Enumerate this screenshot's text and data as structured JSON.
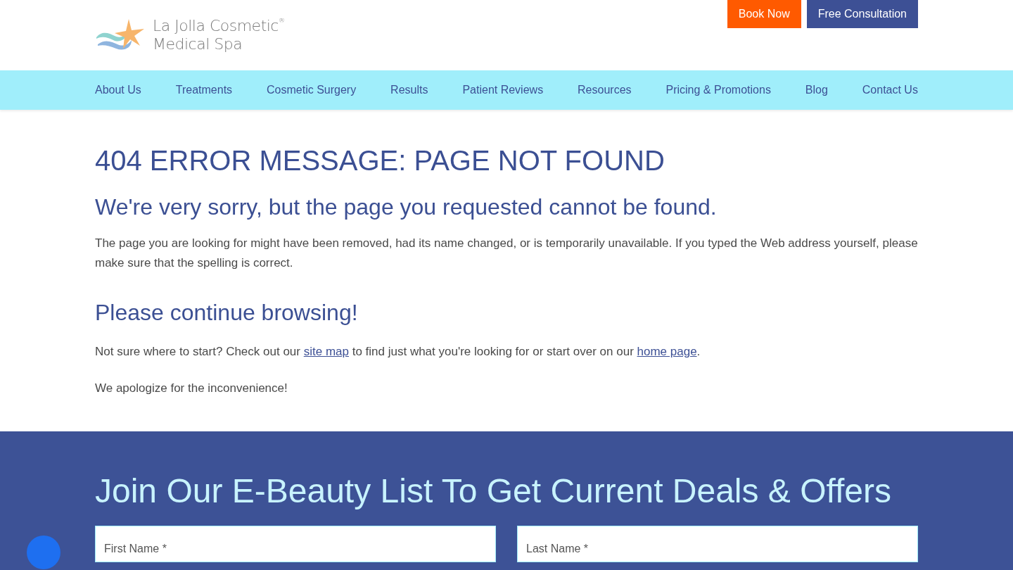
{
  "header": {
    "logo": {
      "line1": "La Jolla Cosmetic",
      "mark": "®",
      "line2": "Medical Spa"
    },
    "buttons": [
      {
        "label": "Book Now",
        "kind": "accent"
      },
      {
        "label": "Free Consultation",
        "kind": "primary"
      }
    ]
  },
  "nav": {
    "items": [
      "About Us",
      "Treatments",
      "Cosmetic Surgery",
      "Results",
      "Patient Reviews",
      "Resources",
      "Pricing & Promotions",
      "Blog",
      "Contact Us"
    ]
  },
  "main": {
    "title": "404 ERROR MESSAGE: PAGE NOT FOUND",
    "subtitle": "We're very sorry, but the page you requested cannot be found.",
    "paragraph": "The page you are looking for might have been removed, had its name changed, or is temporarily unavailable. If you typed the Web address yourself, please make sure that the spelling is correct.",
    "heading2": "Please continue browsing!",
    "browse": [
      {
        "kind": "text",
        "text": "Not sure where to start? Check out our "
      },
      {
        "kind": "link",
        "text": "site map"
      },
      {
        "kind": "text",
        "text": " to find just what you're looking for or start over on our "
      },
      {
        "kind": "link",
        "text": "home page"
      },
      {
        "kind": "text",
        "text": "."
      }
    ],
    "apology": "We apologize for the inconvenience!"
  },
  "signup": {
    "title": "Join Our E-Beauty List To Get Current Deals & Offers",
    "fields": [
      {
        "placeholder": "First Name *"
      },
      {
        "placeholder": "Last Name *"
      }
    ]
  }
}
